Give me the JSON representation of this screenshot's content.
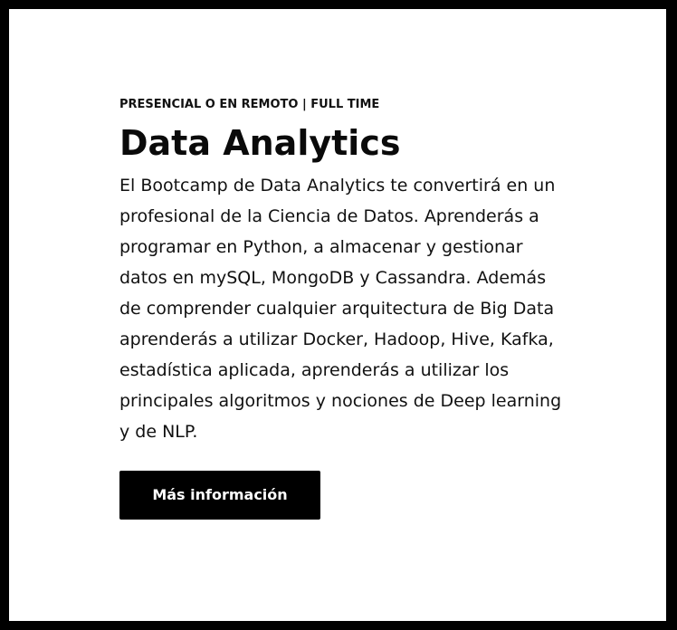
{
  "card": {
    "eyebrow": "PRESENCIAL O EN REMOTO | FULL TIME",
    "title": "Data Analytics",
    "description": "El Bootcamp de Data Analytics te convertirá en un profesional de la Ciencia de Datos. Aprenderás a programar en Python, a almacenar y gestionar datos en mySQL, MongoDB y Cassandra. Además de comprender cualquier arquitectura de Big Data aprenderás a utilizar Docker, Hadoop, Hive, Kafka, estadística aplicada, aprenderás a utilizar los principales algoritmos y nociones de Deep learning y de NLP.",
    "button_label": "Más información"
  },
  "colors": {
    "background": "#000000",
    "card": "#ffffff",
    "button": "#000000",
    "button_text": "#ffffff"
  }
}
